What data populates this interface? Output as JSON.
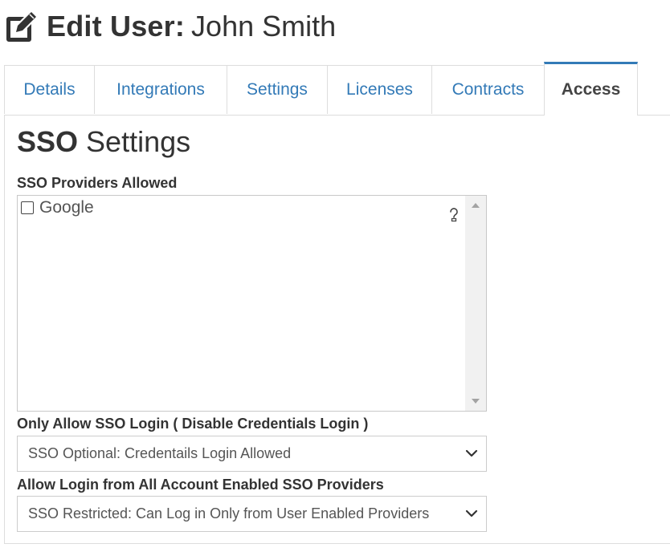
{
  "header": {
    "title_bold": "Edit User:",
    "title_name": "John Smith",
    "icon": "edit-icon"
  },
  "tabs": [
    {
      "label": "Details",
      "active": false
    },
    {
      "label": "Integrations",
      "active": false
    },
    {
      "label": "Settings",
      "active": false
    },
    {
      "label": "Licenses",
      "active": false
    },
    {
      "label": "Contracts",
      "active": false
    },
    {
      "label": "Access",
      "active": true
    }
  ],
  "section": {
    "title_bold": "SSO",
    "title_rest": "Settings"
  },
  "providers": {
    "label": "SSO Providers Allowed",
    "options": [
      {
        "label": "Google",
        "checked": false
      }
    ],
    "help_icon": "question-icon"
  },
  "sso_login": {
    "label": "Only Allow SSO Login ( Disable Credentials Login )",
    "value": "SSO Optional: Credentails Login Allowed"
  },
  "account_providers": {
    "label": "Allow Login from All Account Enabled SSO Providers",
    "value": "SSO Restricted: Can Log in Only from User Enabled Providers"
  },
  "colors": {
    "link": "#337ab7",
    "text": "#333333",
    "border": "#dddddd"
  }
}
